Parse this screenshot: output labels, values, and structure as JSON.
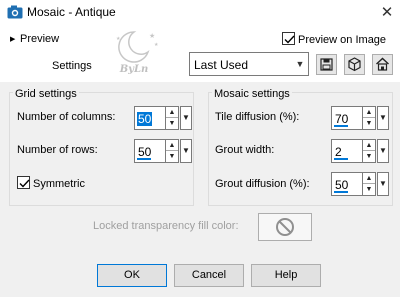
{
  "window": {
    "title": "Mosaic - Antique",
    "app_icon": "camera-icon",
    "close_glyph": "✕"
  },
  "preview": {
    "toggle_label": "Preview",
    "preview_on_image_label": "Preview on Image",
    "preview_on_image_checked": true
  },
  "settings": {
    "label": "Settings",
    "preset_value": "Last Used",
    "buttons": [
      "save-preset-icon",
      "preset-options-icon",
      "reset-icon"
    ]
  },
  "watermark": {
    "text": "ByLn",
    "icon": "moon-stars-icon"
  },
  "grid_settings": {
    "title": "Grid settings",
    "columns_label": "Number of columns:",
    "columns_value": "50",
    "rows_label": "Number of rows:",
    "rows_value": "50",
    "symmetric_label": "Symmetric",
    "symmetric_checked": true
  },
  "mosaic_settings": {
    "title": "Mosaic settings",
    "tile_diffusion_label": "Tile diffusion (%):",
    "tile_diffusion_value": "70",
    "grout_width_label": "Grout width:",
    "grout_width_value": "2",
    "grout_diffusion_label": "Grout diffusion (%):",
    "grout_diffusion_value": "50"
  },
  "locked_fill": {
    "label": "Locked transparency fill color:",
    "swatch_icon": "no-symbol-icon"
  },
  "footer": {
    "ok_label": "OK",
    "cancel_label": "Cancel",
    "help_label": "Help"
  },
  "colors": {
    "accent": "#0078d7",
    "panel_bg": "#f0f0f0",
    "disabled_text": "#a0a0a0"
  }
}
